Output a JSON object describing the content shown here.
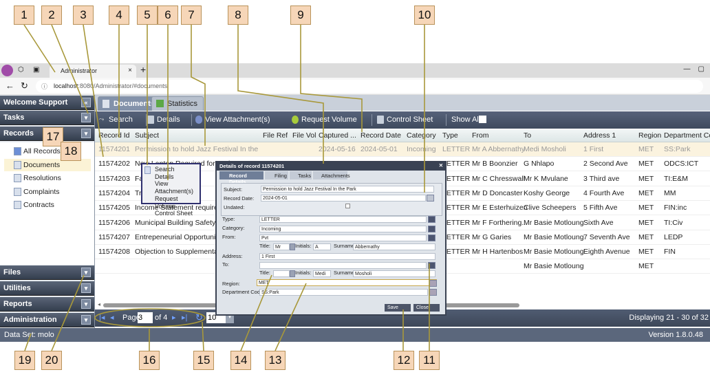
{
  "callouts": {
    "top": [
      "1",
      "2",
      "3",
      "4",
      "5",
      "6",
      "7",
      "8",
      "9",
      "10"
    ],
    "bottom": [
      "11",
      "12",
      "13",
      "14",
      "15",
      "16",
      "19",
      "20"
    ],
    "side": [
      "17",
      "18"
    ]
  },
  "browser": {
    "tab_title": "Administrator",
    "url_host": "localhost",
    "url_rest": ":8080/Administrator/#documents",
    "close": "×",
    "new_tab": "+",
    "back": "←",
    "reload": "↻"
  },
  "sidebar": {
    "welcome": "Welcome Support",
    "tasks": "Tasks",
    "records": "Records",
    "tree": [
      "All Records",
      "Documents",
      "Resolutions",
      "Complaints",
      "Contracts"
    ],
    "files": "Files",
    "utilities": "Utilities",
    "reports": "Reports",
    "administration": "Administration"
  },
  "tabs": [
    "Documents",
    "Statistics"
  ],
  "toolbar": {
    "search": "Search",
    "details": "Details",
    "view_attachments": "View Attachment(s)",
    "request_volume": "Request Volume",
    "control_sheet": "Control Sheet",
    "show_all": "Show All:"
  },
  "columns": [
    "Record Id",
    "Subject",
    "File Ref",
    "File Vol",
    "Captured ...",
    "Record Date",
    "Category",
    "Type",
    "From",
    "To",
    "Address 1",
    "Region",
    "Department Code"
  ],
  "rows": [
    {
      "id": "11574201",
      "subject": "Permission to hold Jazz Festival In the Park",
      "captured": "2024-05-16",
      "date": "2024-05-01",
      "category": "Incoming",
      "type": "LETTER",
      "from": "Mr A Abbernathy",
      "to": "Medi Mosholi",
      "addr": "1 First",
      "region": "MET",
      "dept": "SS:Park"
    },
    {
      "id": "11574202",
      "subject": "New Laptop Required for Bud",
      "type": "LETTER",
      "from": "Mr B Boonzier",
      "to": "G Nhlapo",
      "addr": "2 Second Ave",
      "region": "MET",
      "dept": "ODCS:ICT"
    },
    {
      "id": "11574203",
      "subject": "Fa                     ssula",
      "type": "LETTER",
      "from": "Mr C Chresswall",
      "to": "Mr K Mvulane",
      "addr": "3 Third ave",
      "region": "MET",
      "dept": "TI:E&M"
    },
    {
      "id": "11574204",
      "subject": "Tr                     rming",
      "type": "LETTER",
      "from": "Mr D Doncaster",
      "to": "Koshy George",
      "addr": "4 Fourth Ave",
      "region": "MET",
      "dept": "MM"
    },
    {
      "id": "11574205",
      "subject": "Income Statement required for",
      "type": "LETTER",
      "from": "Mr E Esterhuizen",
      "to": "Clive Scheepers",
      "addr": "5 Fifth Ave",
      "region": "MET",
      "dept": "FIN:inc"
    },
    {
      "id": "11574206",
      "subject": "Municipal Building Safety Appr",
      "type": "LETTER",
      "from": "Mr F Forthering...",
      "to": "Mr Basie Motloung",
      "addr": "Sixth Ave",
      "region": "MET",
      "dept": "TI:Civ"
    },
    {
      "id": "11574207",
      "subject": "Entrepeneurial Opportunities S",
      "type": "LETTER",
      "from": "Mr G Garies",
      "to": "Mr Basie Motloung",
      "addr": "7 Seventh Ave",
      "region": "MET",
      "dept": "LEDP"
    },
    {
      "id": "11574208",
      "subject": "Objection to Supplementary Va",
      "type": "LETTER",
      "from": "Mr H Hartenbos",
      "to": "Mr Basie Motloung",
      "addr": "Eighth Avenue",
      "region": "MET",
      "dept": "FIN"
    },
    {
      "id": "",
      "subject": "",
      "type": "",
      "from": "",
      "to": "Mr Basie Motloung",
      "addr": "",
      "region": "MET",
      "dept": ""
    }
  ],
  "context_menu": [
    "Search",
    "Details",
    "View Attachment(s)",
    "Request Volume",
    "Control Sheet"
  ],
  "dialog": {
    "title": "Details of record 11574201",
    "tabs": [
      "Record Details",
      "Filing",
      "Tasks",
      "Attachments"
    ],
    "labels": {
      "subject": "Subject:",
      "record_date": "Record Date:",
      "undated": "Undated:",
      "type": "Type:",
      "category": "Category:",
      "from": "From:",
      "title": "Title:",
      "initials": "Initials:",
      "surname": "Surname:",
      "address": "Address:",
      "to": "To:",
      "region": "Region:",
      "dept": "Department Code:"
    },
    "values": {
      "subject": "Permission to hold Jazz Festival In the Park",
      "record_date": "2024-05-01",
      "type": "LETTER",
      "category": "Incoming",
      "from": "Pvt",
      "from_title": "Mr",
      "from_initials": "A",
      "from_surname": "Abbernathy",
      "address": "1 First",
      "to": "",
      "to_title": "",
      "to_initials": "Medi",
      "to_surname": "Mosholi",
      "region": "MET",
      "dept": "SS:Park"
    },
    "save": "Save",
    "close": "Close"
  },
  "pager": {
    "page_label": "Page",
    "page": "3",
    "of": "of 4",
    "page_size": "10",
    "displaying": "Displaying 21 - 30 of 32"
  },
  "status": {
    "dataset": "Data Set: molo",
    "version": "Version 1.8.0.48"
  },
  "colors": {
    "accent": "#3f4a5e",
    "callout": "#f6d6b8",
    "leader": "#a8983a",
    "selected_row": "#fbf3df"
  }
}
